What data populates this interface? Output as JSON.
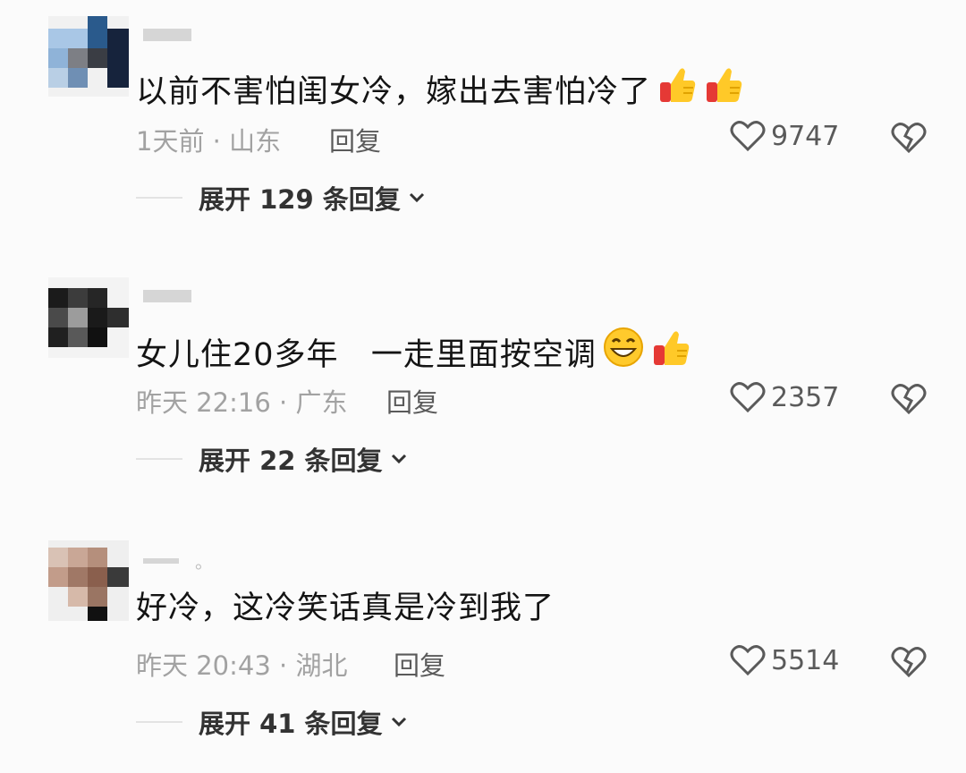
{
  "comments": [
    {
      "text": "以前不害怕闺女冷，嫁出去害怕冷了",
      "emojis": [
        "thumbs-up",
        "thumbs-up"
      ],
      "meta": "1天前 · 山东",
      "reply": "回复",
      "likes": "9747",
      "expand": "展开 129 条回复"
    },
    {
      "text": "女儿住20多年   一走里面按空调",
      "emojis": [
        "grin-face",
        "thumbs-up"
      ],
      "meta": "昨天 22:16 · 广东",
      "reply": "回复",
      "likes": "2357",
      "expand": "展开 22 条回复"
    },
    {
      "username_suffix": "。",
      "text": "好冷，这冷笑话真是冷到我了",
      "emojis": [],
      "meta": "昨天 20:43 · 湖北",
      "reply": "回复",
      "likes": "5514",
      "expand": "展开 41 条回复"
    }
  ]
}
